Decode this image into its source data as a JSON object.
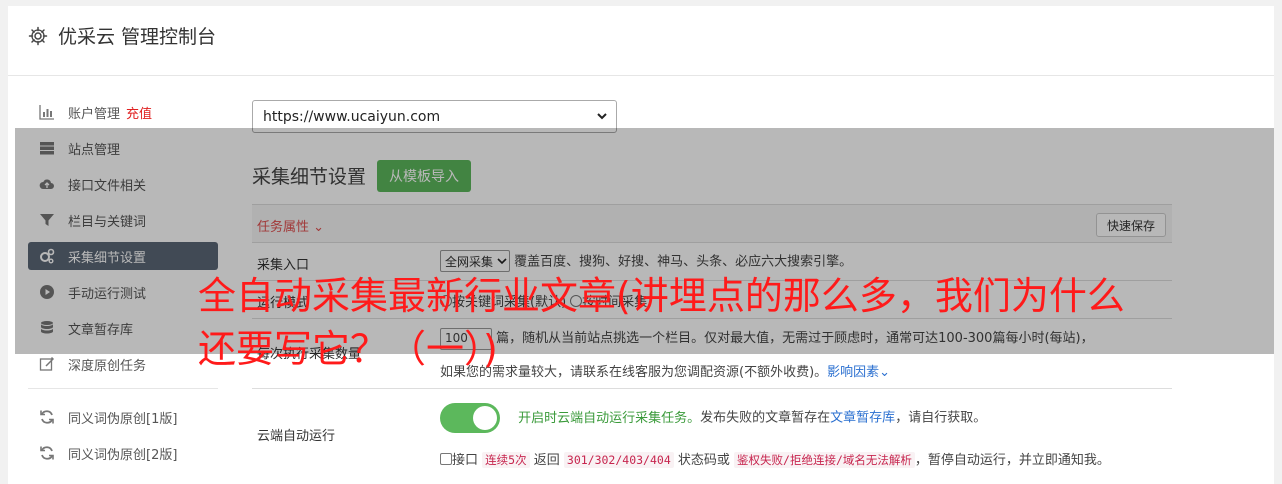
{
  "header": {
    "title": "优采云 管理控制台",
    "icon": "gear-icon"
  },
  "sidebar": {
    "items": [
      {
        "label": "账户管理",
        "badge": "充值",
        "icon": "bar-chart-icon"
      },
      {
        "label": "站点管理",
        "icon": "server-icon"
      },
      {
        "label": "接口文件相关",
        "icon": "cloud-upload-icon"
      },
      {
        "label": "栏目与关键词",
        "icon": "filter-icon"
      },
      {
        "label": "采集细节设置",
        "icon": "gears-icon",
        "active": true
      },
      {
        "label": "手动运行测试",
        "icon": "play-icon"
      },
      {
        "label": "文章暂存库",
        "icon": "database-icon"
      },
      {
        "label": "深度原创任务",
        "icon": "edit-icon"
      }
    ],
    "items2": [
      {
        "label": "同义词伪原创[1版]",
        "icon": "refresh-icon"
      },
      {
        "label": "同义词伪原创[2版]",
        "icon": "refresh-icon"
      }
    ]
  },
  "main": {
    "site_select": "https://www.ucaiyun.com",
    "section_title": "采集细节设置",
    "template_button": "从模板导入",
    "task_attr": "任务属性",
    "quick_save": "快速保存",
    "rows": {
      "entry_label": "采集入口",
      "entry_select": "全网采集",
      "entry_desc": "覆盖百度、搜狗、好搜、神马、头条、必应六大搜索引擎。",
      "mode_label": "运行模式",
      "mode_opt1": "按关键词采集(默认)",
      "mode_opt2": "按时间采集",
      "count_label": "每次执行采集数量",
      "count_value": "100",
      "count_desc": "篇，随机从当前站点挑选一个栏目。仅对最大值，无需过于顾虑时，通常可达100-300篇每小时(每站)，",
      "count_desc2": "如果您的需求量较大，请联系在线客服为您调配资源(不额外收费)。",
      "count_link": "影响因素",
      "cloud_label": "云端自动运行",
      "cloud_on": "开启时云端自动运行采集任务。",
      "cloud_desc": "发布失败的文章暂存在",
      "cloud_link": "文章暂存库",
      "cloud_desc2": "，请自行获取。",
      "iface_label": "接口",
      "iface_code1": "连续5次",
      "iface_t1": "返回",
      "iface_code2": "301/302/403/404",
      "iface_t2": "状态码或",
      "iface_code3": "鉴权失败/拒绝连接/域名无法解析",
      "iface_t3": "，暂停自动运行，并立即通知我。"
    }
  },
  "overlay": {
    "headline": "全自动采集最新行业文章(讲埋点的那么多，我们为什么还要写它？（一）)"
  }
}
